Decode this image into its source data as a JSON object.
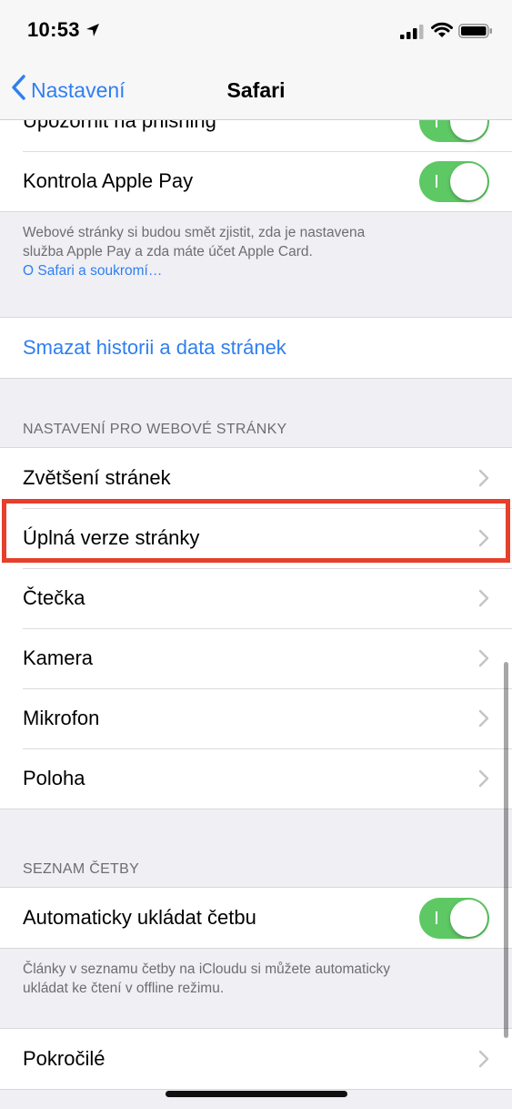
{
  "status_bar": {
    "time": "10:53"
  },
  "nav": {
    "back_label": "Nastavení",
    "title": "Safari"
  },
  "privacy": {
    "phishing_label": "Upozornit na phishing",
    "apple_pay_label": "Kontrola Apple Pay",
    "note_line1": "Webové stránky si budou smět zjistit, zda je nastavena",
    "note_line2": "služba Apple Pay a zda máte účet Apple Card.",
    "note_link": "O Safari a soukromí…"
  },
  "clear": {
    "label": "Smazat historii a data stránek"
  },
  "websites": {
    "header": "NASTAVENÍ PRO WEBOVÉ STRÁNKY",
    "items": [
      {
        "label": "Zvětšení stránek"
      },
      {
        "label": "Úplná verze stránky"
      },
      {
        "label": "Čtečka"
      },
      {
        "label": "Kamera"
      },
      {
        "label": "Mikrofon"
      },
      {
        "label": "Poloha"
      }
    ]
  },
  "reading_list": {
    "header": "SEZNAM ČETBY",
    "auto_save_label": "Automaticky ukládat četbu",
    "note_line1": "Články v seznamu četby na iCloudu si můžete automaticky",
    "note_line2": "ukládat ke čtení v offline režimu."
  },
  "advanced": {
    "label": "Pokročilé"
  },
  "colors": {
    "accent": "#2f7ff0",
    "toggle_on": "#5ec864",
    "highlight": "#e5402b"
  },
  "toggles": {
    "phishing": true,
    "apple_pay": true,
    "auto_save": true
  }
}
